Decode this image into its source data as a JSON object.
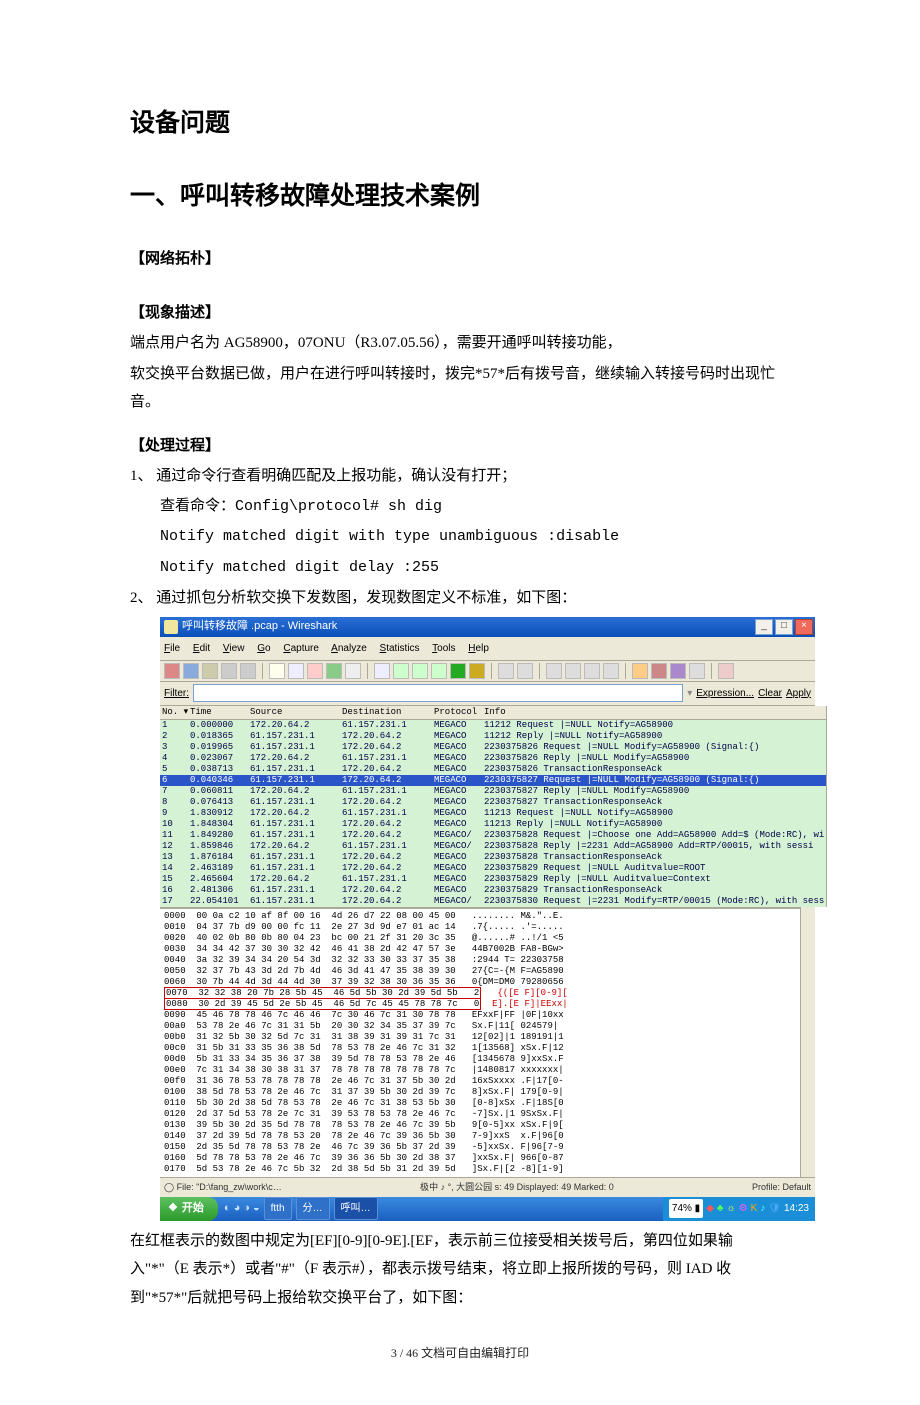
{
  "h1": "设备问题",
  "h2": "一、呼叫转移故障处理技术案例",
  "sect_topo": "【网络拓朴】",
  "sect_desc": "【现象描述】",
  "desc_p1": "端点用户名为 AG58900，07ONU（R3.07.05.56），需要开通呼叫转接功能，",
  "desc_p2": "软交换平台数据已做，用户在进行呼叫转接时，拨完*57*后有拨号音，继续输入转接号码时出现忙音。",
  "sect_proc": "【处理过程】",
  "proc_1": "1、 通过命令行查看明确匹配及上报功能，确认没有打开；",
  "proc_cmd": "查看命令：Config\\protocol# sh dig",
  "proc_l1": "Notify matched digit with type unambiguous       :disable",
  "proc_l2": "Notify matched digit delay      :255",
  "proc_2": "2、 通过抓包分析软交换下发数图，发现数图定义不标准，如下图：",
  "wireshark": {
    "title": "呼叫转移故障 .pcap - Wireshark",
    "menu": [
      "File",
      "Edit",
      "View",
      "Go",
      "Capture",
      "Analyze",
      "Statistics",
      "Tools",
      "Help"
    ],
    "filter_label": "Filter:",
    "filter_exp": "Expression...",
    "filter_clear": "Clear",
    "filter_apply": "Apply",
    "cols": [
      "No. ▾",
      "Time",
      "Source",
      "Destination",
      "Protocol",
      "Info"
    ],
    "rows": [
      {
        "no": "1",
        "t": "0.000000",
        "s": "172.20.64.2",
        "d": "61.157.231.1",
        "p": "MEGACO",
        "i": "11212 Request  |=NULL Notify=AG58900"
      },
      {
        "no": "2",
        "t": "0.018365",
        "s": "61.157.231.1",
        "d": "172.20.64.2",
        "p": "MEGACO",
        "i": "11212 Reply    |=NULL Notify=AG58900"
      },
      {
        "no": "3",
        "t": "0.019965",
        "s": "61.157.231.1",
        "d": "172.20.64.2",
        "p": "MEGACO",
        "i": "2230375826 Request |=NULL Modify=AG58900 (Signal:{)"
      },
      {
        "no": "4",
        "t": "0.023067",
        "s": "172.20.64.2",
        "d": "61.157.231.1",
        "p": "MEGACO",
        "i": "2230375826 Reply   |=NULL Modify=AG58900"
      },
      {
        "no": "5",
        "t": "0.038713",
        "s": "61.157.231.1",
        "d": "172.20.64.2",
        "p": "MEGACO",
        "i": "2230375826 TransactionResponseAck"
      },
      {
        "no": "6",
        "t": "0.040346",
        "s": "61.157.231.1",
        "d": "172.20.64.2",
        "p": "MEGACO",
        "i": "2230375827 Request |=NULL Modify=AG58900 (Signal:{)",
        "sel": true
      },
      {
        "no": "7",
        "t": "0.060811",
        "s": "172.20.64.2",
        "d": "61.157.231.1",
        "p": "MEGACO",
        "i": "2230375827 Reply   |=NULL Modify=AG58900"
      },
      {
        "no": "8",
        "t": "0.076413",
        "s": "61.157.231.1",
        "d": "172.20.64.2",
        "p": "MEGACO",
        "i": "2230375827 TransactionResponseAck"
      },
      {
        "no": "9",
        "t": "1.830912",
        "s": "172.20.64.2",
        "d": "61.157.231.1",
        "p": "MEGACO",
        "i": "11213 Request  |=NULL Notify=AG58900"
      },
      {
        "no": "10",
        "t": "1.848304",
        "s": "61.157.231.1",
        "d": "172.20.64.2",
        "p": "MEGACO",
        "i": "11213 Reply    |=NULL Notify=AG58900"
      },
      {
        "no": "11",
        "t": "1.849280",
        "s": "61.157.231.1",
        "d": "172.20.64.2",
        "p": "MEGACO/",
        "i": "2230375828 Request |=Choose one Add=AG58900 Add=$ (Mode:RC), wi"
      },
      {
        "no": "12",
        "t": "1.859846",
        "s": "172.20.64.2",
        "d": "61.157.231.1",
        "p": "MEGACO/",
        "i": "2230375828 Reply   |=2231 Add=AG58900 Add=RTP/00015, with sessi"
      },
      {
        "no": "13",
        "t": "1.876184",
        "s": "61.157.231.1",
        "d": "172.20.64.2",
        "p": "MEGACO",
        "i": "2230375828 TransactionResponseAck"
      },
      {
        "no": "14",
        "t": "2.463189",
        "s": "61.157.231.1",
        "d": "172.20.64.2",
        "p": "MEGACO",
        "i": "2230375829 Request |=NULL Auditvalue=ROOT"
      },
      {
        "no": "15",
        "t": "2.465604",
        "s": "172.20.64.2",
        "d": "61.157.231.1",
        "p": "MEGACO",
        "i": "2230375829 Reply   |=NULL Auditvalue=Context"
      },
      {
        "no": "16",
        "t": "2.481306",
        "s": "61.157.231.1",
        "d": "172.20.64.2",
        "p": "MEGACO",
        "i": "2230375829 TransactionResponseAck"
      },
      {
        "no": "17",
        "t": "22.054101",
        "s": "61.157.231.1",
        "d": "172.20.64.2",
        "p": "MEGACO/",
        "i": "2230375830 Request |=2231 Modify=RTP/00015 (Mode:RC), with sess"
      }
    ],
    "hex": [
      "0000  00 0a c2 10 af 8f 00 16  4d 26 d7 22 08 00 45 00   ........ M&.\"..E.",
      "0010  04 37 7b d9 00 00 fc 11  2e 27 3d 9d e7 01 ac 14   .7{..... .'=.....",
      "0020  40 02 0b 80 0b 80 04 23  bc 00 21 2f 31 20 3c 35   @......# ..!/1 <5",
      "0030  34 34 42 37 30 30 32 42  46 41 38 2d 42 47 57 3e   44B7002B FA8-BGw>",
      "0040  3a 32 39 34 34 20 54 3d  32 32 33 30 33 37 35 38   :2944 T= 22303758",
      "0050  32 37 7b 43 3d 2d 7b 4d  46 3d 41 47 35 38 39 30   27{C=-{M F=AG5890",
      "0060  30 7b 44 4d 3d 44 4d 30  37 39 32 38 30 36 35 36   0{DM=DM0 79280656"
    ],
    "hex_red": [
      "0070  32 32 38 20 7b 28 5b 45  46 5d 5b 30 2d 39 5d 5b   228 {([E F][0-9][",
      "0080  30 2d 39 45 5d 2e 5b 45  46 5d 7c 45 45 78 78 7c   0-9E].[E F]|EExx|"
    ],
    "hex2": [
      "0090  45 46 78 78 46 7c 46 46  7c 30 46 7c 31 30 78 78   EFxxF|FF |0F|10xx",
      "00a0  53 78 2e 46 7c 31 31 5b  20 30 32 34 35 37 39 7c   Sx.F|11[ 024579|",
      "00b0  31 32 5b 30 32 5d 7c 31  31 38 39 31 39 31 7c 31   12[02]|1 189191|1",
      "00c0  31 5b 31 33 35 36 38 5d  78 53 78 2e 46 7c 31 32   1[13568] xSx.F|12",
      "00d0  5b 31 33 34 35 36 37 38  39 5d 78 78 53 78 2e 46   [1345678 9]xxSx.F",
      "00e0  7c 31 34 38 30 38 31 37  78 78 78 78 78 78 78 7c   |1480817 xxxxxxx|",
      "00f0  31 36 78 53 78 78 78 78  2e 46 7c 31 37 5b 30 2d   16xSxxxx .F|17[0-",
      "0100  38 5d 78 53 78 2e 46 7c  31 37 39 5b 30 2d 39 7c   8]xSx.F| 179[0-9|",
      "0110  5b 30 2d 38 5d 78 53 78  2e 46 7c 31 38 53 5b 30   [0-8]xSx .F|18S[0",
      "0120  2d 37 5d 53 78 2e 7c 31  39 53 78 53 78 2e 46 7c   -7]Sx.|1 9SxSx.F|",
      "0130  39 5b 30 2d 35 5d 78 78  78 53 78 2e 46 7c 39 5b   9[0-5]xx xSx.F|9[",
      "0140  37 2d 39 5d 78 78 53 20  78 2e 46 7c 39 36 5b 30   7-9]xxS  x.F|96[0",
      "0150  2d 35 5d 78 78 53 78 2e  46 7c 39 36 5b 37 2d 39   -5]xxSx. F|96[7-9",
      "0160  5d 78 78 53 78 2e 46 7c  39 36 36 5b 30 2d 38 37   ]xxSx.F| 966[0-87",
      "0170  5d 53 78 2e 46 7c 5b 32  2d 38 5d 5b 31 2d 39 5d   ]Sx.F|[2 -8][1-9]"
    ],
    "status_left": "File: \"D:\\fang_zw\\work\\c…",
    "status_mid": "中 ♪ °, 大圆公园 s: 49 Displayed: 49 Marked: 0",
    "status_right": "Profile: Default",
    "taskbar": {
      "start": "开始",
      "btns": [
        "　",
        "ftth",
        "　",
        "　",
        "分…",
        "呼叫…"
      ],
      "batt": "74%",
      "time": "14:23"
    }
  },
  "after_p1": "在红框表示的数图中规定为[EF][0-9][0-9E].[EF，表示前三位接受相关拨号后，第四位如果输入\"*\"（E 表示*）或者\"#\"（F 表示#），都表示拨号结束，将立即上报所拨的号码，则 IAD 收到\"*57*\"后就把号码上报给软交换平台了，如下图：",
  "footer": "3 / 46 文档可自由编辑打印"
}
